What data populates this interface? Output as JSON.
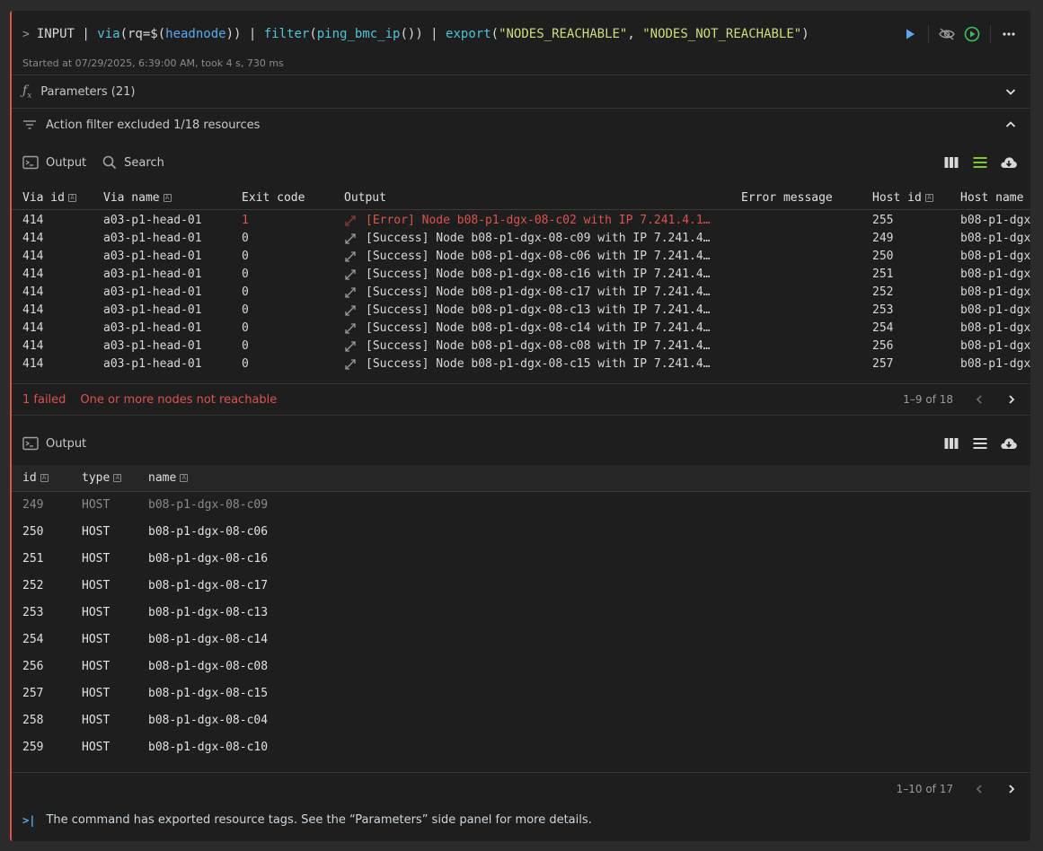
{
  "command": {
    "prompt": ">",
    "parts": [
      {
        "text": "INPUT | ",
        "style": "plain"
      },
      {
        "text": "via",
        "style": "cyan"
      },
      {
        "text": "(rq=$(",
        "style": "plain"
      },
      {
        "text": "headnode",
        "style": "blue"
      },
      {
        "text": ")) | ",
        "style": "plain"
      },
      {
        "text": "filter",
        "style": "cyan"
      },
      {
        "text": "(",
        "style": "plain"
      },
      {
        "text": "ping_bmc_ip",
        "style": "cyan"
      },
      {
        "text": "()) | ",
        "style": "plain"
      },
      {
        "text": "export",
        "style": "cyan"
      },
      {
        "text": "(",
        "style": "plain"
      },
      {
        "text": "\"NODES_REACHABLE\"",
        "style": "str"
      },
      {
        "text": ", ",
        "style": "plain"
      },
      {
        "text": "\"NODES_NOT_REACHABLE\"",
        "style": "str"
      },
      {
        "text": ")",
        "style": "plain"
      }
    ],
    "started": "Started at 07/29/2025, 6:39:00 AM, took 4 s, 730 ms"
  },
  "parameters": {
    "label": "Parameters (21)"
  },
  "action_filter": {
    "label": "Action filter excluded 1/18 resources"
  },
  "toolbar1": {
    "output_label": "Output",
    "search_label": "Search"
  },
  "table1": {
    "columns": [
      "Via id",
      "Via name",
      "Exit code",
      "Output",
      "Error message",
      "Host id",
      "Host name"
    ],
    "rows": [
      {
        "via_id": "414",
        "via_name": "a03-p1-head-01",
        "exit": "1",
        "output": "[Error] Node b08-p1-dgx-08-c02 with IP 7.241.4.1…",
        "error": "",
        "host_id": "255",
        "host_name": "b08-p1-dgx",
        "failed": true
      },
      {
        "via_id": "414",
        "via_name": "a03-p1-head-01",
        "exit": "0",
        "output": "[Success] Node b08-p1-dgx-08-c09 with IP 7.241.4…",
        "error": "",
        "host_id": "249",
        "host_name": "b08-p1-dgx",
        "failed": false
      },
      {
        "via_id": "414",
        "via_name": "a03-p1-head-01",
        "exit": "0",
        "output": "[Success] Node b08-p1-dgx-08-c06 with IP 7.241.4…",
        "error": "",
        "host_id": "250",
        "host_name": "b08-p1-dgx",
        "failed": false
      },
      {
        "via_id": "414",
        "via_name": "a03-p1-head-01",
        "exit": "0",
        "output": "[Success] Node b08-p1-dgx-08-c16 with IP 7.241.4…",
        "error": "",
        "host_id": "251",
        "host_name": "b08-p1-dgx",
        "failed": false
      },
      {
        "via_id": "414",
        "via_name": "a03-p1-head-01",
        "exit": "0",
        "output": "[Success] Node b08-p1-dgx-08-c17 with IP 7.241.4…",
        "error": "",
        "host_id": "252",
        "host_name": "b08-p1-dgx",
        "failed": false
      },
      {
        "via_id": "414",
        "via_name": "a03-p1-head-01",
        "exit": "0",
        "output": "[Success] Node b08-p1-dgx-08-c13 with IP 7.241.4…",
        "error": "",
        "host_id": "253",
        "host_name": "b08-p1-dgx",
        "failed": false
      },
      {
        "via_id": "414",
        "via_name": "a03-p1-head-01",
        "exit": "0",
        "output": "[Success] Node b08-p1-dgx-08-c14 with IP 7.241.4…",
        "error": "",
        "host_id": "254",
        "host_name": "b08-p1-dgx",
        "failed": false
      },
      {
        "via_id": "414",
        "via_name": "a03-p1-head-01",
        "exit": "0",
        "output": "[Success] Node b08-p1-dgx-08-c08 with IP 7.241.4…",
        "error": "",
        "host_id": "256",
        "host_name": "b08-p1-dgx",
        "failed": false
      },
      {
        "via_id": "414",
        "via_name": "a03-p1-head-01",
        "exit": "0",
        "output": "[Success] Node b08-p1-dgx-08-c15 with IP 7.241.4…",
        "error": "",
        "host_id": "257",
        "host_name": "b08-p1-dgx",
        "failed": false
      }
    ],
    "failed_label": "1 failed",
    "failed_message": "One or more nodes not reachable",
    "pager": "1–9 of 18"
  },
  "toolbar2": {
    "output_label": "Output"
  },
  "table2": {
    "columns": [
      "id",
      "type",
      "name"
    ],
    "rows": [
      {
        "id": "249",
        "type": "HOST",
        "name": "b08-p1-dgx-08-c09",
        "dim": true
      },
      {
        "id": "250",
        "type": "HOST",
        "name": "b08-p1-dgx-08-c06",
        "dim": false
      },
      {
        "id": "251",
        "type": "HOST",
        "name": "b08-p1-dgx-08-c16",
        "dim": false
      },
      {
        "id": "252",
        "type": "HOST",
        "name": "b08-p1-dgx-08-c17",
        "dim": false
      },
      {
        "id": "253",
        "type": "HOST",
        "name": "b08-p1-dgx-08-c13",
        "dim": false
      },
      {
        "id": "254",
        "type": "HOST",
        "name": "b08-p1-dgx-08-c14",
        "dim": false
      },
      {
        "id": "256",
        "type": "HOST",
        "name": "b08-p1-dgx-08-c08",
        "dim": false
      },
      {
        "id": "257",
        "type": "HOST",
        "name": "b08-p1-dgx-08-c15",
        "dim": false
      },
      {
        "id": "258",
        "type": "HOST",
        "name": "b08-p1-dgx-08-c04",
        "dim": false
      },
      {
        "id": "259",
        "type": "HOST",
        "name": "b08-p1-dgx-08-c10",
        "dim": false
      }
    ],
    "pager": "1–10 of 17"
  },
  "note": {
    "icon": ">|",
    "text": "The command has exported resource tags. See the “Parameters” side panel for more details."
  },
  "colors": {
    "accent_error": "#d9534f",
    "accent_blue": "#5aa9f0",
    "accent_green": "#7ec832",
    "run_green": "#3fbf62"
  }
}
